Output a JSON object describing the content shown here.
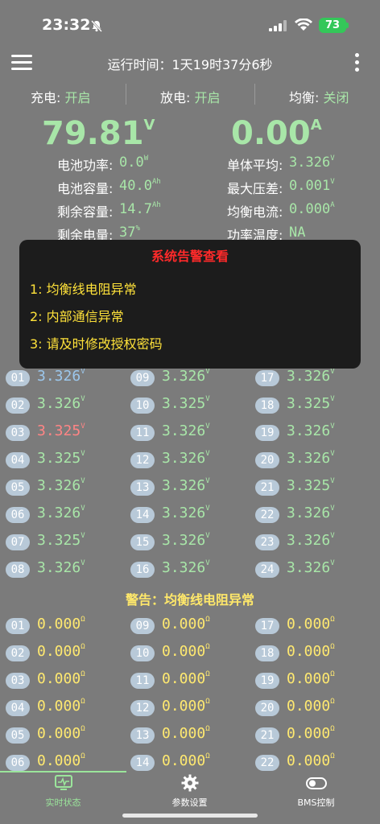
{
  "status_bar": {
    "time": "23:32",
    "battery": "73"
  },
  "header": {
    "runtime_label": "运行时间：",
    "runtime_value": "1天19时37分6秒"
  },
  "switches": [
    {
      "label": "充电: ",
      "value": "开启"
    },
    {
      "label": "放电: ",
      "value": "开启"
    },
    {
      "label": "均衡: ",
      "value": "关闭"
    }
  ],
  "main": {
    "voltage": "79.81",
    "voltage_unit": "V",
    "current": "0.00",
    "current_unit": "A"
  },
  "stats_left": [
    {
      "label": "电池功率:",
      "value": "0.0",
      "unit": "W"
    },
    {
      "label": "电池容量:",
      "value": "40.0",
      "unit": "Ah"
    },
    {
      "label": "剩余容量:",
      "value": "14.7",
      "unit": "Ah"
    },
    {
      "label": "剩余电量:",
      "value": "37",
      "unit": "%"
    }
  ],
  "stats_right": [
    {
      "label": "单体平均:",
      "value": "3.326",
      "unit": "V"
    },
    {
      "label": "最大压差:",
      "value": "0.001",
      "unit": "V"
    },
    {
      "label": "均衡电流:",
      "value": "0.000",
      "unit": "A"
    },
    {
      "label": "功率温度:",
      "value": "NA",
      "unit": ""
    }
  ],
  "modal": {
    "title": "系统告警查看",
    "items": [
      "1: 均衡线电阻异常",
      "2: 内部通信异常",
      "3: 请及时修改授权密码"
    ]
  },
  "voltages": {
    "unit": "V",
    "col1": [
      {
        "n": "01",
        "v": "3.326"
      },
      {
        "n": "02",
        "v": "3.326"
      },
      {
        "n": "03",
        "v": "3.325"
      },
      {
        "n": "04",
        "v": "3.325"
      },
      {
        "n": "05",
        "v": "3.326"
      },
      {
        "n": "06",
        "v": "3.326"
      },
      {
        "n": "07",
        "v": "3.325"
      },
      {
        "n": "08",
        "v": "3.326"
      }
    ],
    "col2": [
      {
        "n": "09",
        "v": "3.326"
      },
      {
        "n": "10",
        "v": "3.325"
      },
      {
        "n": "11",
        "v": "3.326"
      },
      {
        "n": "12",
        "v": "3.326"
      },
      {
        "n": "13",
        "v": "3.326"
      },
      {
        "n": "14",
        "v": "3.326"
      },
      {
        "n": "15",
        "v": "3.326"
      },
      {
        "n": "16",
        "v": "3.326"
      }
    ],
    "col3": [
      {
        "n": "17",
        "v": "3.326"
      },
      {
        "n": "18",
        "v": "3.325"
      },
      {
        "n": "19",
        "v": "3.326"
      },
      {
        "n": "20",
        "v": "3.326"
      },
      {
        "n": "21",
        "v": "3.325"
      },
      {
        "n": "22",
        "v": "3.326"
      },
      {
        "n": "23",
        "v": "3.326"
      },
      {
        "n": "24",
        "v": "3.326"
      }
    ]
  },
  "warning": "警告：均衡线电阻异常",
  "resistance": {
    "unit": "Ω",
    "col1": [
      {
        "n": "01",
        "v": "0.000"
      },
      {
        "n": "02",
        "v": "0.000"
      },
      {
        "n": "03",
        "v": "0.000"
      },
      {
        "n": "04",
        "v": "0.000"
      },
      {
        "n": "05",
        "v": "0.000"
      },
      {
        "n": "06",
        "v": "0.000"
      }
    ],
    "col2": [
      {
        "n": "09",
        "v": "0.000"
      },
      {
        "n": "10",
        "v": "0.000"
      },
      {
        "n": "11",
        "v": "0.000"
      },
      {
        "n": "12",
        "v": "0.000"
      },
      {
        "n": "13",
        "v": "0.000"
      },
      {
        "n": "14",
        "v": "0.000"
      }
    ],
    "col3": [
      {
        "n": "17",
        "v": "0.000"
      },
      {
        "n": "18",
        "v": "0.000"
      },
      {
        "n": "19",
        "v": "0.000"
      },
      {
        "n": "20",
        "v": "0.000"
      },
      {
        "n": "21",
        "v": "0.000"
      },
      {
        "n": "22",
        "v": "0.000"
      }
    ]
  },
  "tabs": [
    {
      "label": "实时状态",
      "icon": "monitor-icon"
    },
    {
      "label": "参数设置",
      "icon": "gear-icon"
    },
    {
      "label": "BMS控制",
      "icon": "toggle-icon"
    }
  ]
}
